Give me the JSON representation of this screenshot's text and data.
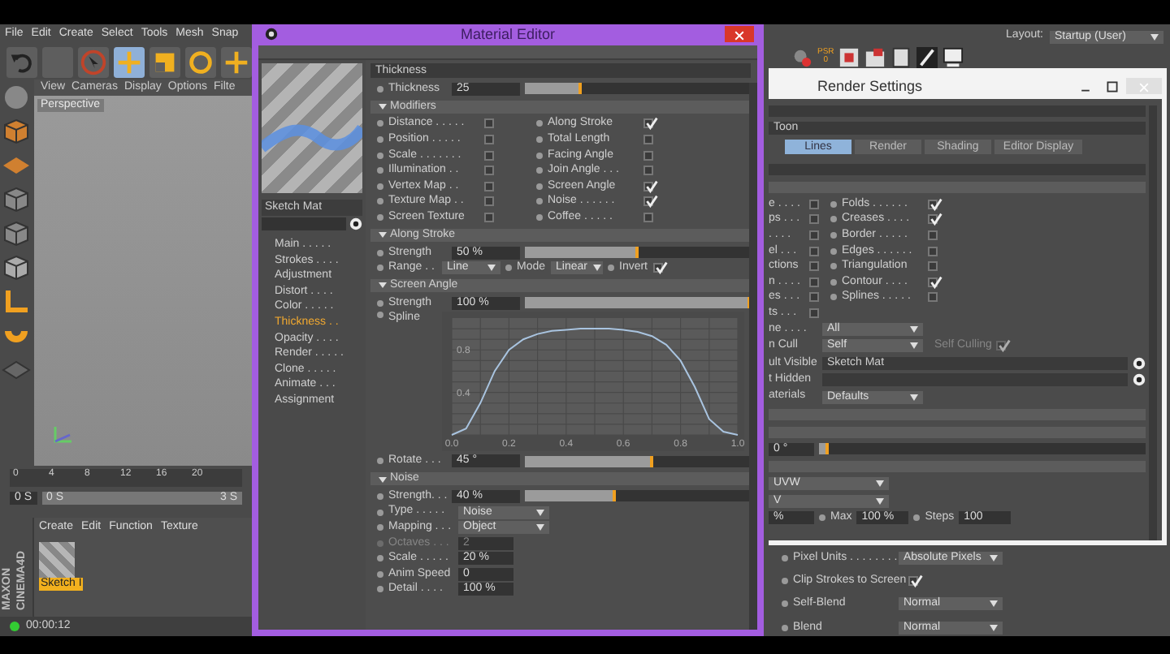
{
  "app": {
    "menu": [
      "File",
      "Edit",
      "Create",
      "Select",
      "Tools",
      "Mesh",
      "Snap"
    ],
    "layout": {
      "label": "Layout:",
      "value": "Startup (User)"
    },
    "psr": {
      "label": "PSR",
      "value": "0"
    },
    "viewport": {
      "menu": [
        "View",
        "Cameras",
        "Display",
        "Options",
        "Filte"
      ],
      "camera": "Perspective"
    },
    "timeline": {
      "ticks": [
        "0",
        "4",
        "8",
        "12",
        "16",
        "20"
      ],
      "current_frame": "0 S",
      "range_start": "0 S",
      "range_end": "3 S",
      "level": 1
    },
    "material_manager": {
      "menu": [
        "Create",
        "Edit",
        "Function",
        "Texture"
      ],
      "materials": [
        {
          "name": "Sketch I",
          "selected": true
        }
      ]
    },
    "logo": {
      "line_1": "MAXON",
      "line_2": "CINEMA4D"
    },
    "status_bar": {
      "time": "00:00:12"
    },
    "attributes": [
      {
        "kind": "dropdown",
        "label": "Pixel Units . . . . . . . .",
        "value": "Absolute Pixels"
      },
      {
        "kind": "check",
        "label": "Clip Strokes to Screen",
        "checked": true
      },
      {
        "kind": "dropdown",
        "label": "Self-Blend",
        "value": "Normal"
      },
      {
        "kind": "dropdown",
        "label": "Blend",
        "value": "Normal"
      }
    ]
  },
  "material_editor": {
    "title": "Material Editor",
    "material_name": "Sketch Mat",
    "nav": [
      {
        "label": "Main . . . . .",
        "selected": false
      },
      {
        "label": "Strokes . . . .",
        "selected": false
      },
      {
        "label": "Adjustment",
        "selected": false
      },
      {
        "label": "Distort . . . .",
        "selected": false
      },
      {
        "label": "Color . . . . .",
        "selected": false
      },
      {
        "label": "Thickness . .",
        "selected": true
      },
      {
        "label": "Opacity . . . .",
        "selected": false
      },
      {
        "label": "Render . . . . .",
        "selected": false
      },
      {
        "label": "Clone . . . . .",
        "selected": false
      },
      {
        "label": "Animate . . .",
        "selected": false
      },
      {
        "label": "Assignment",
        "selected": false
      }
    ],
    "panel_title": "Thickness",
    "items": [
      {
        "kind": "slider",
        "label": "Thickness",
        "value": "25",
        "level": 0.25
      },
      {
        "kind": "header",
        "label": "Modifiers",
        "expanded": true
      },
      {
        "kind": "checkgrid",
        "columns": [
          [
            {
              "label": "Distance . . . . .",
              "checked": false
            },
            {
              "label": "Position . . . . .",
              "checked": false
            },
            {
              "label": "Scale . . . . . . .",
              "checked": false
            },
            {
              "label": "Illumination . .",
              "checked": false
            },
            {
              "label": "Vertex Map . .",
              "checked": false
            },
            {
              "label": "Texture Map . .",
              "checked": false
            },
            {
              "label": "Screen Texture",
              "checked": false
            }
          ],
          [
            {
              "label": "Along Stroke",
              "checked": true
            },
            {
              "label": "Total Length",
              "checked": false
            },
            {
              "label": "Facing Angle",
              "checked": false
            },
            {
              "label": "Join Angle . . .",
              "checked": false
            },
            {
              "label": "Screen Angle",
              "checked": true
            },
            {
              "label": "Noise . . . . . .",
              "checked": true
            },
            {
              "label": "Coffee . . . . .",
              "checked": false
            }
          ]
        ]
      },
      {
        "kind": "header",
        "label": "Along Stroke",
        "expanded": true
      },
      {
        "kind": "slider",
        "label": "Strength",
        "value": "50 %",
        "level": 0.5
      },
      {
        "kind": "range",
        "label": "Range . .",
        "value": "Line",
        "mode_label": "Mode",
        "mode_value": "Linear",
        "invert_label": "Invert",
        "invert_checked": true
      },
      {
        "kind": "header",
        "label": "Screen Angle",
        "expanded": true
      },
      {
        "kind": "slider",
        "label": "Strength",
        "value": "100 %",
        "level": 1
      },
      {
        "kind": "spline",
        "chart_data": {
          "type": "line",
          "grid": true,
          "x": [
            0,
            0.05,
            0.1,
            0.15,
            0.2,
            0.25,
            0.3,
            0.35,
            0.4,
            0.45,
            0.5,
            0.55,
            0.6,
            0.65,
            0.7,
            0.75,
            0.8,
            0.85,
            0.9,
            0.95,
            1
          ],
          "series": [
            {
              "name": "Spline",
              "color": "#a9c4e0",
              "values": [
                0,
                0.06,
                0.3,
                0.6,
                0.8,
                0.9,
                0.95,
                0.98,
                0.99,
                1,
                1,
                1,
                0.99,
                0.97,
                0.93,
                0.85,
                0.7,
                0.45,
                0.15,
                0.03,
                0
              ]
            }
          ],
          "xlim": [
            0,
            1
          ],
          "ylim": [
            0,
            1.1
          ],
          "xticks": [
            {
              "value": 0,
              "label": "0.0"
            },
            {
              "value": 0.2,
              "label": "0.2"
            },
            {
              "value": 0.4,
              "label": "0.4"
            },
            {
              "value": 0.6,
              "label": "0.6"
            },
            {
              "value": 0.8,
              "label": "0.8"
            },
            {
              "value": 1,
              "label": "1.0"
            }
          ],
          "yticks": [
            {
              "value": 0.4,
              "label": "0.4"
            },
            {
              "value": 0.8,
              "label": "0.8"
            }
          ]
        }
      },
      {
        "kind": "slider",
        "label": "Rotate . . .",
        "value": "45 °",
        "level": 0.57
      },
      {
        "kind": "header",
        "label": "Noise",
        "expanded": true
      },
      {
        "kind": "slider",
        "label": "Strength. . .",
        "value": "40 %",
        "level": 0.4
      },
      {
        "kind": "dropdown",
        "label": "Type . . . . .",
        "value": "Noise"
      },
      {
        "kind": "dropdown",
        "label": "Mapping . . .",
        "value": "Object"
      },
      {
        "kind": "number",
        "label": "Octaves . . .",
        "value": "2",
        "disabled": true
      },
      {
        "kind": "number",
        "label": "Scale . . . . .",
        "value": "20 %",
        "disabled": false
      },
      {
        "kind": "number",
        "label": "Anim Speed",
        "value": "0",
        "disabled": false
      },
      {
        "kind": "number",
        "label": "Detail . . . .",
        "value": "100 %",
        "disabled": false
      }
    ]
  },
  "render_settings": {
    "title": "Render Settings",
    "section": "Toon",
    "tabs": [
      {
        "label": "Lines",
        "selected": true
      },
      {
        "label": "Render",
        "selected": false
      },
      {
        "label": "Shading",
        "selected": false
      },
      {
        "label": "Editor Display",
        "selected": false
      }
    ],
    "line_types": [
      [
        {
          "label": "e . . . .",
          "checked": false
        },
        {
          "label": "ps . . .",
          "checked": false
        },
        {
          "label": ". . . .",
          "checked": false
        },
        {
          "label": "el . . .",
          "checked": false
        },
        {
          "label": "ctions",
          "checked": false
        },
        {
          "label": "n . . . .",
          "checked": false
        },
        {
          "label": "es . . .",
          "checked": false
        },
        {
          "label": "ts . . .",
          "checked": false
        }
      ],
      [
        {
          "label": "Folds . . . . . .",
          "checked": true
        },
        {
          "label": "Creases . . . .",
          "checked": true
        },
        {
          "label": "Border . . . . .",
          "checked": false
        },
        {
          "label": "Edges . . . . . .",
          "checked": false
        },
        {
          "label": "Triangulation",
          "checked": false
        },
        {
          "label": "Contour . . . .",
          "checked": true
        },
        {
          "label": "Splines . . . . .",
          "checked": false
        }
      ]
    ],
    "rows": [
      {
        "kind": "dropdown",
        "label": "ne . . . .",
        "value": "All"
      },
      {
        "kind": "dropdown",
        "label": "n Cull",
        "value": "Self",
        "option_label": "Self Culling",
        "option_checked": true,
        "option_disabled": true
      },
      {
        "kind": "link",
        "label": "ult Visible",
        "value": "Sketch Mat"
      },
      {
        "kind": "link",
        "label": "t Hidden"
      },
      {
        "kind": "dropdown",
        "label": "aterials",
        "value": "Defaults"
      },
      {
        "kind": "bar"
      },
      {
        "kind": "bar"
      },
      {
        "kind": "slider",
        "value": "0 °",
        "level": 0.03
      },
      {
        "kind": "bar"
      },
      {
        "kind": "dropdown",
        "value": "UVW"
      },
      {
        "kind": "dropdown",
        "value": "V"
      },
      {
        "kind": "minmax",
        "min": "%",
        "max_label": "Max",
        "max": "100 %",
        "steps_label": "Steps",
        "steps": "100"
      }
    ]
  }
}
